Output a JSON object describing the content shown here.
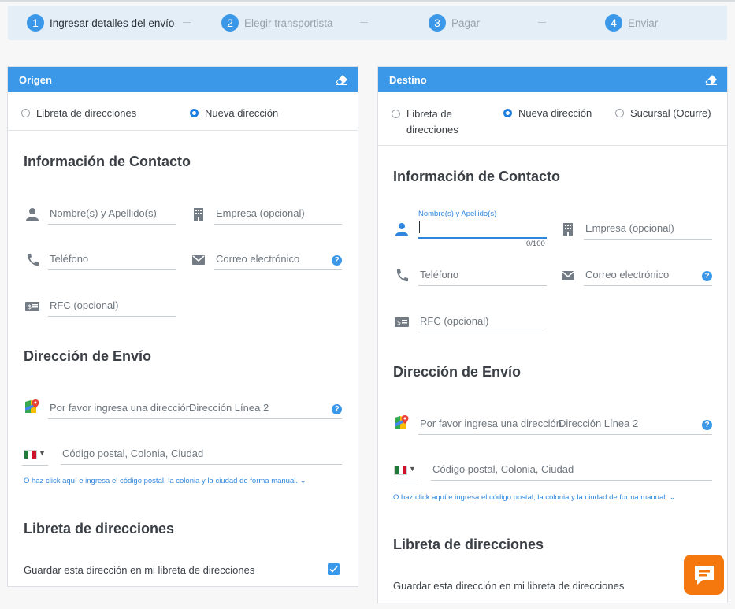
{
  "stepper": {
    "steps": [
      {
        "num": "1",
        "label": "Ingresar detalles del envío"
      },
      {
        "num": "2",
        "label": "Elegir transportista"
      },
      {
        "num": "3",
        "label": "Pagar"
      },
      {
        "num": "4",
        "label": "Enviar"
      }
    ]
  },
  "origin": {
    "title": "Origen",
    "radios": [
      "Libreta de direcciones",
      "Nueva dirección"
    ],
    "contact_title": "Información de Contacto",
    "name_ph": "Nombre(s) y Apellido(s)",
    "company_ph": "Empresa (opcional)",
    "phone_ph": "Teléfono",
    "email_ph": "Correo electrónico",
    "rfc_ph": "RFC (opcional)",
    "shipping_title": "Dirección de Envío",
    "address_ph": "Por favor ingresa una dirección.",
    "address2_ph": "Dirección Línea 2",
    "zip_ph": "Código postal, Colonia, Ciudad",
    "manual_link": "O haz click aquí e ingresa el código postal, la colonia y la ciudad de forma manual.",
    "book_title": "Libreta de direcciones",
    "save_label": "Guardar esta dirección en mi libreta de direcciones",
    "help": "?"
  },
  "destination": {
    "title": "Destino",
    "radios": [
      "Libreta de",
      "direcciones",
      "Nueva dirección",
      "Sucursal (Ocurre)"
    ],
    "contact_title": "Información de Contacto",
    "name_label": "Nombre(s) y Apellido(s)",
    "name_counter": "0/100",
    "company_ph": "Empresa (opcional)",
    "phone_ph": "Teléfono",
    "email_ph": "Correo electrónico",
    "rfc_ph": "RFC (opcional)",
    "shipping_title": "Dirección de Envío",
    "address_ph": "Por favor ingresa una dirección.",
    "address2_ph": "Dirección Línea 2",
    "zip_ph": "Código postal, Colonia, Ciudad",
    "manual_link": "O haz click aquí e ingresa el código postal, la colonia y la ciudad de forma manual.",
    "book_title": "Libreta de direcciones",
    "save_label": "Guardar esta dirección en mi libreta de direcciones",
    "help": "?"
  },
  "colors": {
    "accent": "#3b98e8",
    "link": "#2e86de",
    "chat": "#f5780f"
  },
  "icons": [
    "eraser-icon",
    "person-icon",
    "building-icon",
    "phone-icon",
    "mail-icon",
    "id-card-icon",
    "maps-pin-icon",
    "mexico-flag-icon",
    "chat-icon",
    "check-icon",
    "help-icon"
  ]
}
